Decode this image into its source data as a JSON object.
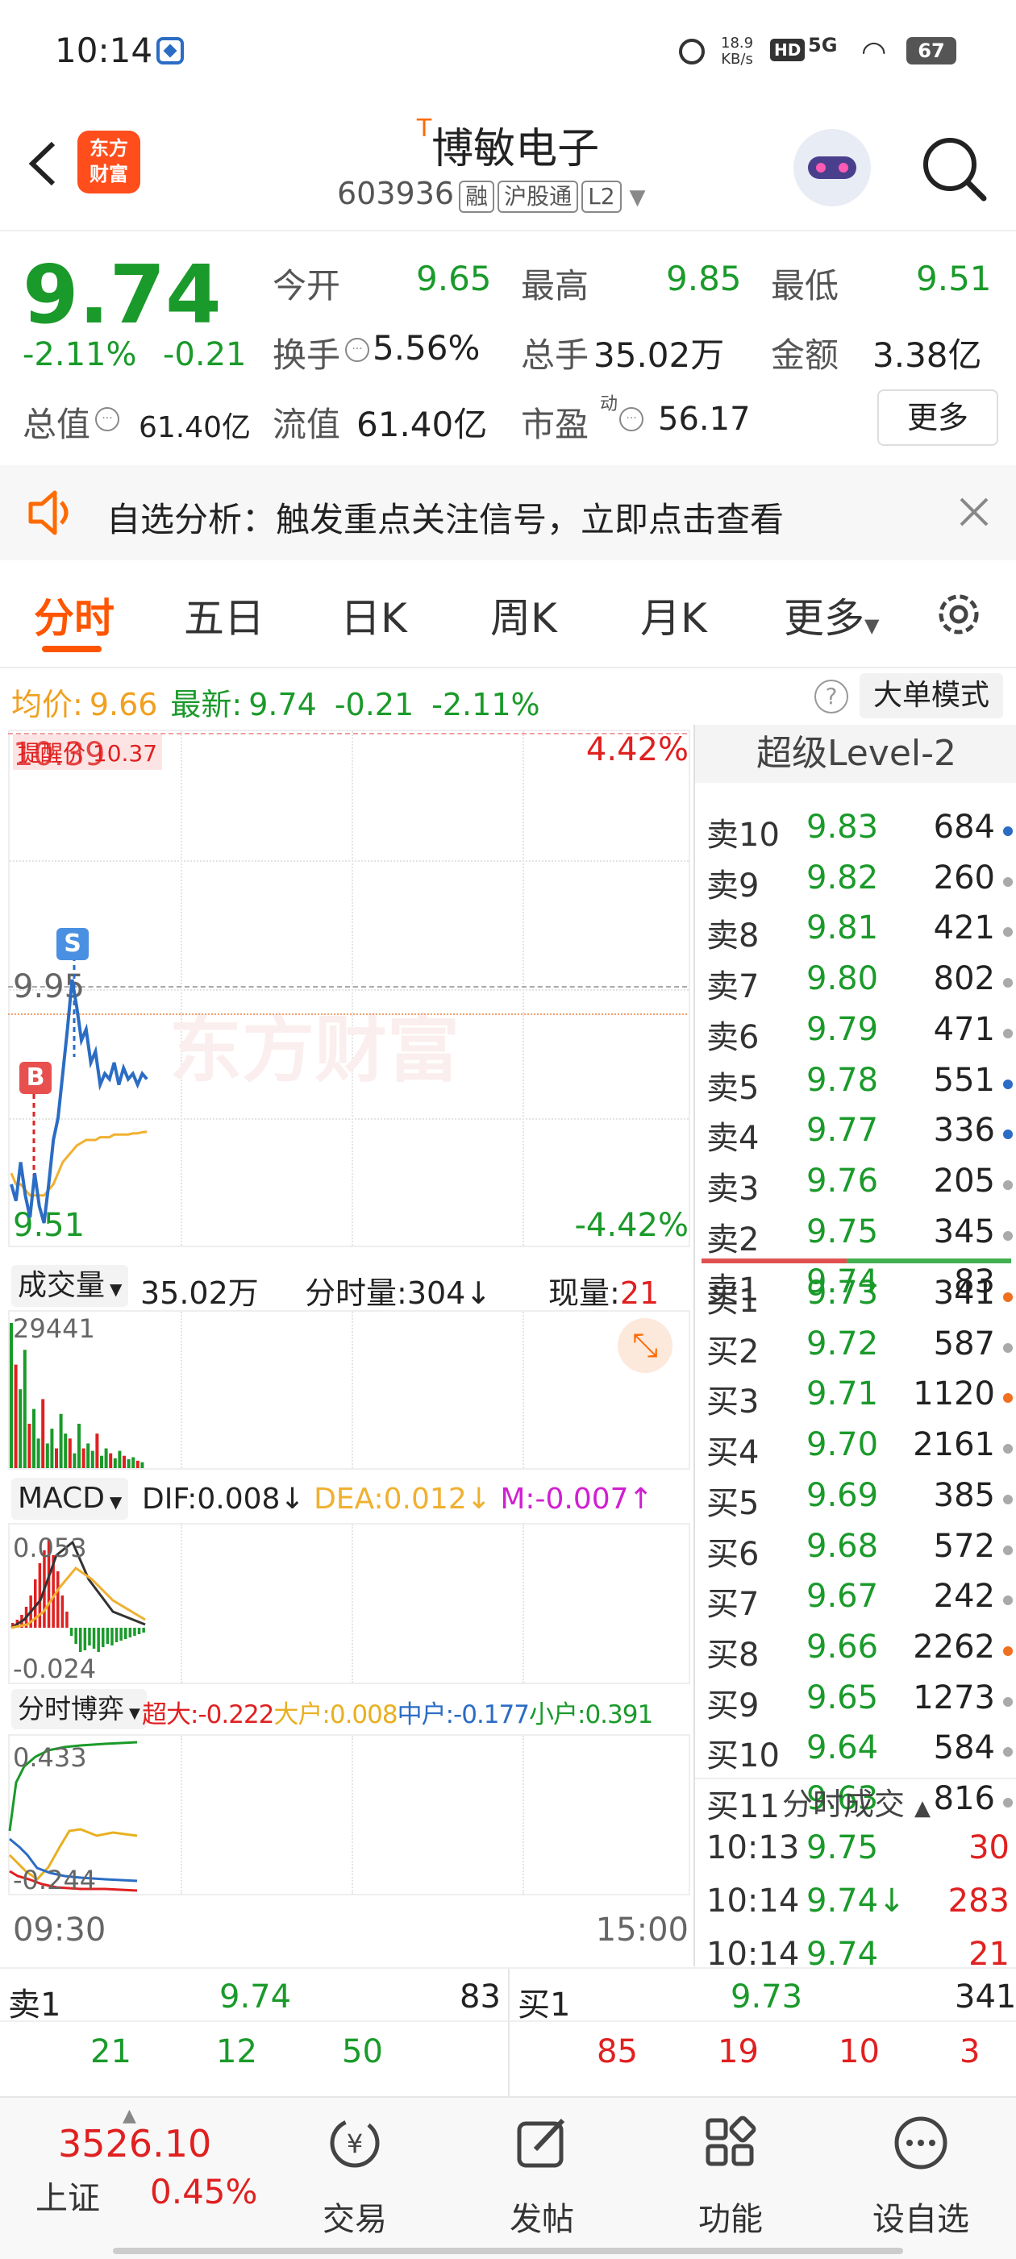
{
  "status_bar": {
    "time": "10:14",
    "net_speed_value": "18.9",
    "net_speed_unit": "KB/s",
    "hd": "HD",
    "signal": "5G",
    "battery": "67"
  },
  "header": {
    "logo_line1": "东方",
    "logo_line2": "财富",
    "title_prefix": "T",
    "title": "博敏电子",
    "code": "603936",
    "tag_rong": "融",
    "tag_hgt": "沪股通",
    "tag_l2": "L2"
  },
  "quote": {
    "price": "9.74",
    "change_pct": "-2.11%",
    "change": "-0.21",
    "open_label": "今开",
    "open": "9.65",
    "high_label": "最高",
    "high": "9.85",
    "low_label": "最低",
    "low": "9.51",
    "turnover_label": "换手",
    "turnover": "5.56%",
    "volume_label": "总手",
    "volume": "35.02万",
    "amount_label": "金额",
    "amount": "3.38亿",
    "mktcap_label": "总值",
    "mktcap": "61.40亿",
    "float_label": "流值",
    "float": "61.40亿",
    "pe_label": "市盈",
    "pe_sup": "动",
    "pe": "56.17",
    "more_button": "更多"
  },
  "alert": {
    "text": "自选分析：触发重点关注信号，立即点击查看"
  },
  "tabs": {
    "items": [
      "分时",
      "五日",
      "日K",
      "周K",
      "月K",
      "更多"
    ],
    "active": 0
  },
  "info_row": {
    "avg_label": "均价:",
    "avg": "9.66",
    "latest_label": "最新:",
    "latest": "9.74",
    "change": "-0.21",
    "change_pct": "-2.11%",
    "help": "?",
    "big_order_button": "大单模式"
  },
  "chart": {
    "top_price": "10.39",
    "reminder_text": "提醒价 10.37",
    "top_pct": "4.42%",
    "mid_price": "9.95",
    "bottom_price": "9.51",
    "bottom_pct": "-4.42%",
    "marker_s": "S",
    "marker_b": "B",
    "watermark": "东方财富",
    "time_start": "09:30",
    "time_end": "15:00",
    "colors": {
      "price_line": "#2b6cc4",
      "avg_line": "#f0b030",
      "up": "#e02020",
      "down": "#1a9a2a"
    },
    "price_series": [
      9.58,
      9.55,
      9.62,
      9.56,
      9.52,
      9.6,
      9.54,
      9.51,
      9.58,
      9.66,
      9.7,
      9.78,
      9.86,
      9.95,
      9.9,
      9.84,
      9.86,
      9.8,
      9.82,
      9.76,
      9.78,
      9.77,
      9.8,
      9.76,
      9.79,
      9.77,
      9.78,
      9.76,
      9.78,
      9.77
    ],
    "avg_series": [
      9.6,
      9.58,
      9.58,
      9.57,
      9.56,
      9.56,
      9.56,
      9.56,
      9.57,
      9.58,
      9.6,
      9.62,
      9.63,
      9.64,
      9.65,
      9.655,
      9.66,
      9.66,
      9.66,
      9.665,
      9.665,
      9.665,
      9.67,
      9.67,
      9.67,
      9.67,
      9.672,
      9.672,
      9.674,
      9.675
    ]
  },
  "volume_panel": {
    "selector": "成交量",
    "total": "35.02万",
    "tick_vol_label": "分时量:",
    "tick_vol": "304",
    "current_label": "现量:",
    "current": "21",
    "max_label": "29441",
    "bars": [
      29441,
      21000,
      16000,
      24000,
      9000,
      12000,
      6000,
      14000,
      5000,
      8000,
      4000,
      11000,
      7000,
      6000,
      3000,
      9000,
      4000,
      5000,
      3500,
      7000,
      2500,
      4000,
      3000,
      2000,
      3500,
      2500,
      1800,
      2200,
      1500,
      1200
    ]
  },
  "macd_panel": {
    "selector": "MACD",
    "dif_label": "DIF:",
    "dif": "0.008",
    "dea_label": "DEA:",
    "dea": "0.012",
    "m_label": "M:",
    "m": "-0.007",
    "top_label": "0.053",
    "bottom_label": "-0.024"
  },
  "game_panel": {
    "selector": "分时博弈",
    "super_label": "超大:",
    "super": "-0.222",
    "big_label": "大户:",
    "big": "0.008",
    "mid_label": "中户:",
    "mid": "-0.177",
    "small_label": "小户:",
    "small": "0.391",
    "top_label": "0.433",
    "bottom_label": "-0.244"
  },
  "order_book": {
    "title": "超级Level-2",
    "asks": [
      {
        "label": "卖10",
        "price": "9.83",
        "vol": "684",
        "dot": "#2b6cc4"
      },
      {
        "label": "卖9",
        "price": "9.82",
        "vol": "260",
        "dot": "#aaaaaa"
      },
      {
        "label": "卖8",
        "price": "9.81",
        "vol": "421",
        "dot": "#aaaaaa"
      },
      {
        "label": "卖7",
        "price": "9.80",
        "vol": "802",
        "dot": "#aaaaaa"
      },
      {
        "label": "卖6",
        "price": "9.79",
        "vol": "471",
        "dot": "#aaaaaa"
      },
      {
        "label": "卖5",
        "price": "9.78",
        "vol": "551",
        "dot": "#2b6cc4"
      },
      {
        "label": "卖4",
        "price": "9.77",
        "vol": "336",
        "dot": "#2b6cc4"
      },
      {
        "label": "卖3",
        "price": "9.76",
        "vol": "205",
        "dot": "#aaaaaa"
      },
      {
        "label": "卖2",
        "price": "9.75",
        "vol": "345",
        "dot": "#aaaaaa"
      },
      {
        "label": "卖1",
        "price": "9.74",
        "vol": "83",
        "dot": ""
      }
    ],
    "bids": [
      {
        "label": "买1",
        "price": "9.73",
        "vol": "341",
        "dot": "#f07020"
      },
      {
        "label": "买2",
        "price": "9.72",
        "vol": "587",
        "dot": "#aaaaaa"
      },
      {
        "label": "买3",
        "price": "9.71",
        "vol": "1120",
        "dot": "#f07020"
      },
      {
        "label": "买4",
        "price": "9.70",
        "vol": "2161",
        "dot": "#aaaaaa"
      },
      {
        "label": "买5",
        "price": "9.69",
        "vol": "385",
        "dot": "#aaaaaa"
      },
      {
        "label": "买6",
        "price": "9.68",
        "vol": "572",
        "dot": "#aaaaaa"
      },
      {
        "label": "买7",
        "price": "9.67",
        "vol": "242",
        "dot": "#aaaaaa"
      },
      {
        "label": "买8",
        "price": "9.66",
        "vol": "2262",
        "dot": "#f07020"
      },
      {
        "label": "买9",
        "price": "9.65",
        "vol": "1273",
        "dot": "#aaaaaa"
      },
      {
        "label": "买10",
        "price": "9.64",
        "vol": "584",
        "dot": "#aaaaaa"
      },
      {
        "label": "买11",
        "price": "9.63",
        "vol": "816",
        "dot": "#aaaaaa"
      }
    ],
    "trades_title": "分时成交",
    "trades": [
      {
        "time": "10:13",
        "price": "9.75",
        "arrow": "",
        "vol": "30"
      },
      {
        "time": "10:14",
        "price": "9.74",
        "arrow": "↓",
        "vol": "283"
      },
      {
        "time": "10:14",
        "price": "9.74",
        "arrow": "",
        "vol": "21"
      }
    ]
  },
  "bottom_panel": {
    "ask_label": "卖1",
    "ask_price": "9.74",
    "ask_vol": "83",
    "ask_queue": [
      "21",
      "12",
      "50"
    ],
    "bid_label": "买1",
    "bid_price": "9.73",
    "bid_vol": "341",
    "bid_queue": [
      "85",
      "19",
      "10",
      "3"
    ]
  },
  "tab_bar": {
    "index_value": "3526.10",
    "index_name": "上证",
    "index_pct": "0.45%",
    "trade": "交易",
    "post": "发帖",
    "functions": "功能",
    "watchlist": "设自选"
  }
}
